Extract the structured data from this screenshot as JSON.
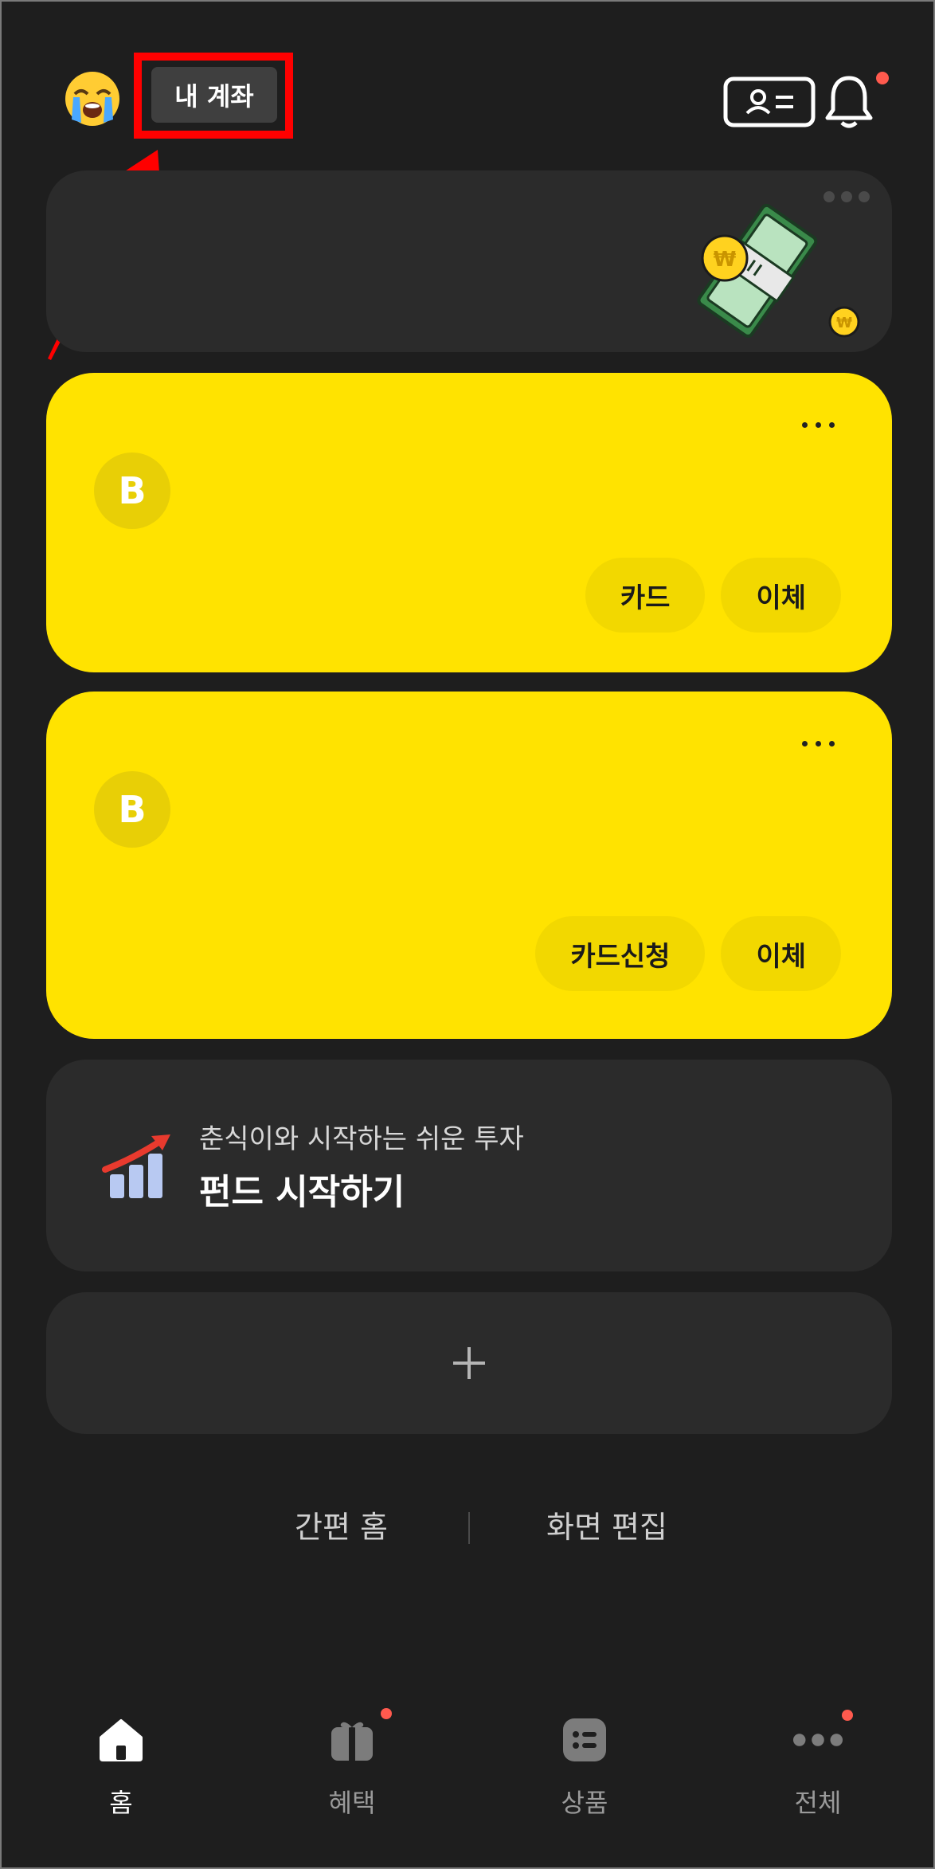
{
  "header": {
    "account_label": "내 계좌",
    "avatar_emoji": "😭",
    "id_card_icon": "id-card-icon",
    "bell_icon": "bell-icon",
    "has_notification": true
  },
  "banner": {
    "illustration": "money-bundle-illustration"
  },
  "accounts": [
    {
      "logo_letter": "B",
      "actions": [
        "카드",
        "이체"
      ]
    },
    {
      "logo_letter": "B",
      "actions": [
        "카드신청",
        "이체"
      ]
    }
  ],
  "fund": {
    "subtitle": "춘식이와 시작하는 쉬운 투자",
    "title": "펀드 시작하기",
    "icon": "rising-chart-icon"
  },
  "add_card": {
    "icon": "plus-icon"
  },
  "footer_links": {
    "simple_home": "간편 홈",
    "edit_screen": "화면 편집"
  },
  "tabs": [
    {
      "label": "홈",
      "icon": "home-icon",
      "active": true
    },
    {
      "label": "혜택",
      "icon": "gift-icon",
      "badge": true
    },
    {
      "label": "상품",
      "icon": "list-icon"
    },
    {
      "label": "전체",
      "icon": "more-icon",
      "badge": true
    }
  ],
  "colors": {
    "background": "#1e1e1e",
    "card_dark": "#2b2b2b",
    "card_yellow": "#ffe300",
    "highlight": "#ff0000",
    "badge": "#ff5a4e"
  }
}
